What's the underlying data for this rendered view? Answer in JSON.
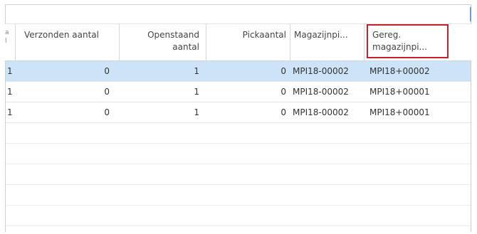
{
  "columns": [
    {
      "line1": "Verzonden aantal",
      "line2": ""
    },
    {
      "line1": "Openstaand",
      "line2": "aantal"
    },
    {
      "line1": "Pickaantal",
      "line2": ""
    },
    {
      "line1": "Magazijnpi...",
      "line2": ""
    },
    {
      "line1": "Gereg.",
      "line2": "magazijnpi..."
    }
  ],
  "rows": [
    {
      "edge": "1",
      "verzonden": "0",
      "openstaand": "1",
      "pick": "0",
      "magazijnpick": "MPI18-00002",
      "geregistreerd": "MPI18+00002",
      "selected": true
    },
    {
      "edge": "1",
      "verzonden": "0",
      "openstaand": "1",
      "pick": "0",
      "magazijnpick": "MPI18-00002",
      "geregistreerd": "MPI18+00001",
      "selected": false
    },
    {
      "edge": "1",
      "verzonden": "0",
      "openstaand": "1",
      "pick": "0",
      "magazijnpick": "MPI18-00002",
      "geregistreerd": "MPI18+00001",
      "selected": false
    }
  ],
  "colors": {
    "selected_row": "#cde3f7",
    "highlight_box": "#c8202b"
  }
}
